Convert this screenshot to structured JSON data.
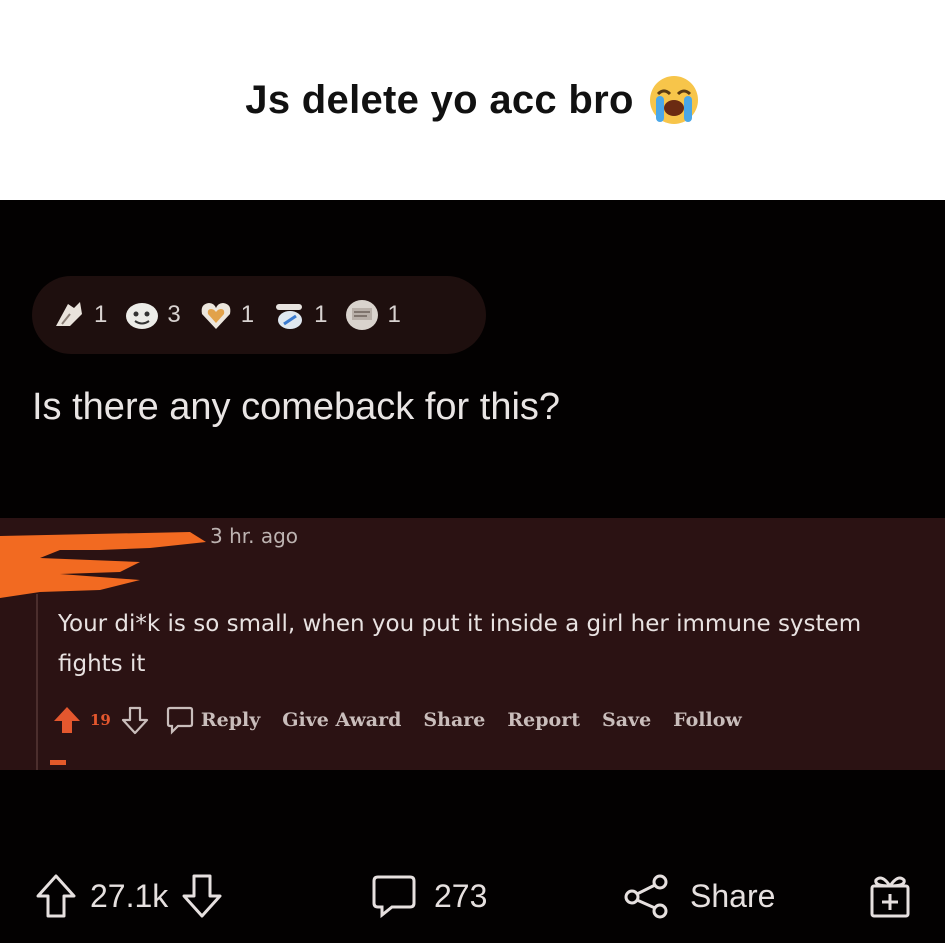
{
  "caption": {
    "text": "Js delete yo acc bro",
    "emoji": "loudly-crying-face-emoji"
  },
  "post": {
    "awards": [
      {
        "icon": "award-helpful-icon",
        "count": "1"
      },
      {
        "icon": "award-wholesome-icon",
        "count": "3"
      },
      {
        "icon": "award-heart-icon",
        "count": "1"
      },
      {
        "icon": "award-bless-icon",
        "count": "1"
      },
      {
        "icon": "award-sign-icon",
        "count": "1"
      }
    ],
    "title": "Is there any comeback for this?"
  },
  "comment": {
    "time": "3 hr. ago",
    "body": "Your di*k is so small, when you put it inside a girl her immune system fights it",
    "votes": "19",
    "actions": {
      "reply": "Reply",
      "give_award": "Give Award",
      "share": "Share",
      "report": "Report",
      "save": "Save",
      "follow": "Follow"
    }
  },
  "bottom": {
    "upvotes": "27.1k",
    "comments": "273",
    "share": "Share"
  },
  "colors": {
    "background": "#030101",
    "card": "#2b1213",
    "upvote": "#e4572e",
    "redaction": "#f26a21"
  }
}
